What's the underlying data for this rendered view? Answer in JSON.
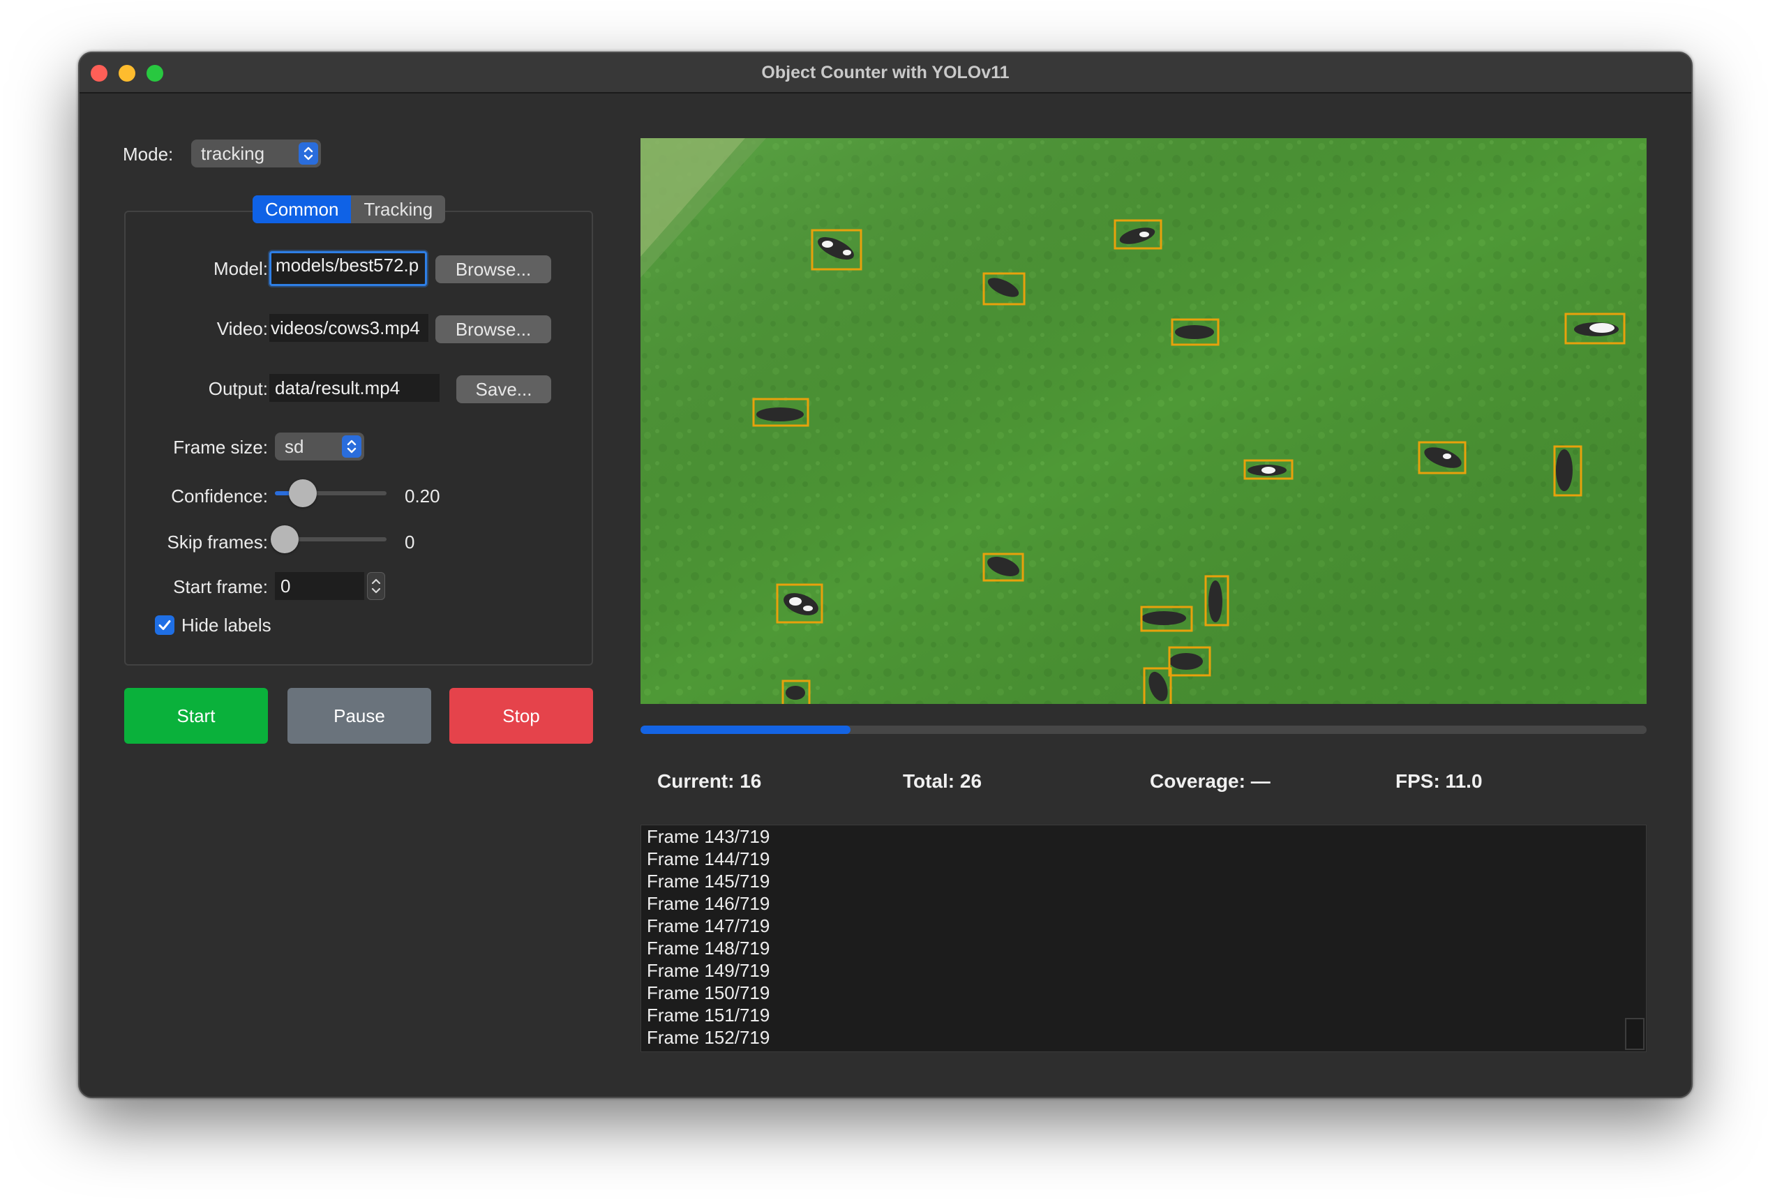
{
  "window": {
    "title": "Object Counter with YOLOv11"
  },
  "mode": {
    "label": "Mode:",
    "value": "tracking"
  },
  "tabs": [
    {
      "label": "Common"
    },
    {
      "label": "Tracking"
    }
  ],
  "form": {
    "model_label": "Model:",
    "model_value": "models/best572.p",
    "model_browse": "Browse...",
    "video_label": "Video:",
    "video_value": "videos/cows3.mp4",
    "video_browse": "Browse...",
    "output_label": "Output:",
    "output_value": "data/result.mp4",
    "output_save": "Save...",
    "frame_size_label": "Frame size:",
    "frame_size_value": "sd",
    "confidence_label": "Confidence:",
    "confidence_value": "0.20",
    "confidence_level": 0.2,
    "skip_label": "Skip frames:",
    "skip_value": "0",
    "skip_level": 0,
    "start_frame_label": "Start frame:",
    "start_frame_value": "0",
    "hide_labels_label": "Hide labels",
    "hide_labels_checked": true
  },
  "buttons": {
    "start": "Start",
    "pause": "Pause",
    "stop": "Stop"
  },
  "progress": {
    "fraction": 0.209
  },
  "stats": {
    "current": "Current: 16",
    "total": "Total: 26",
    "coverage": "Coverage: —",
    "fps": "FPS: 11.0"
  },
  "log": [
    "Frame 143/719",
    "Frame 144/719",
    "Frame 145/719",
    "Frame 146/719",
    "Frame 147/719",
    "Frame 148/719",
    "Frame 149/719",
    "Frame 150/719",
    "Frame 151/719",
    "Frame 152/719"
  ],
  "colors": {
    "accent": "#0f62e6",
    "start": "#0ab13b",
    "pause": "#6a737c",
    "stop": "#e5434b",
    "detection_box": "#e8a10c"
  }
}
